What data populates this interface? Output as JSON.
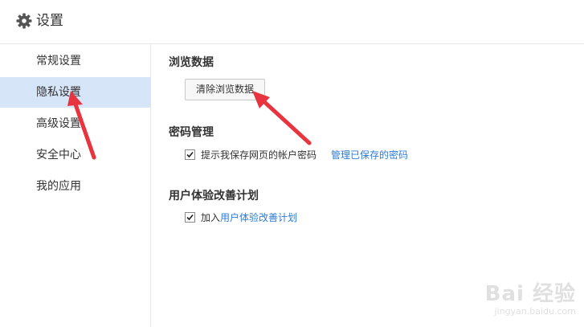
{
  "header": {
    "title": "设置",
    "icon": "gear-icon"
  },
  "sidebar": {
    "items": [
      {
        "label": "常规设置"
      },
      {
        "label": "隐私设置",
        "active": true
      },
      {
        "label": "高级设置"
      },
      {
        "label": "安全中心"
      },
      {
        "label": "我的应用"
      }
    ]
  },
  "browsing_data": {
    "title": "浏览数据",
    "clear_button": "清除浏览数据"
  },
  "password": {
    "title": "密码管理",
    "prompt_label": "提示我保存网页的帐户密码",
    "prompt_checked": true,
    "manage_link": "管理已保存的密码"
  },
  "experience": {
    "title": "用户体验改善计划",
    "join_prefix": "加入",
    "join_link": "用户体验改善计划",
    "join_checked": true
  },
  "watermark": {
    "main": "Bai 经验",
    "sub": "jingyan.baidu.com"
  },
  "colors": {
    "active_bg": "#d7e5f8",
    "link": "#2f7bd6",
    "arrow": "#e8343f"
  }
}
